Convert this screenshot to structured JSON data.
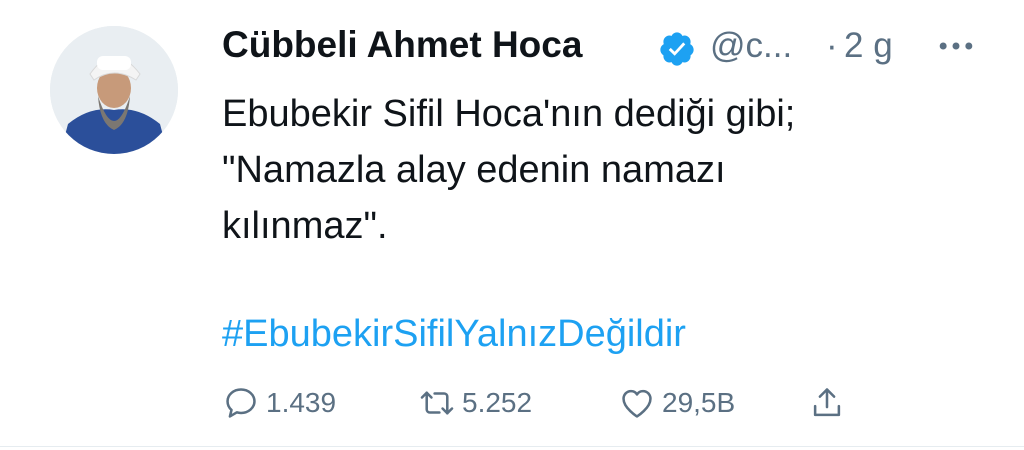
{
  "user": {
    "name": "Cübbeli Ahmet Hoca",
    "handle": "@c...",
    "time_separator": "·",
    "time": "2 g"
  },
  "tweet": {
    "lines": [
      "Ebubekir Sifil Hoca'nın dediği gibi;",
      "\"Namazla alay edenin namazı",
      "kılınmaz\"."
    ],
    "hashtag": "#EbubekirSifilYalnızDeğildir"
  },
  "actions": {
    "replies": "1.439",
    "retweets": "5.252",
    "likes": "29,5B"
  },
  "icons": {
    "verified": "verified-badge-icon",
    "more": "more-options-icon",
    "reply": "reply-icon",
    "retweet": "retweet-icon",
    "like": "heart-icon",
    "share": "share-icon"
  },
  "colors": {
    "accent": "#1da1f2",
    "text": "#0f1419",
    "muted": "#5b7083"
  }
}
